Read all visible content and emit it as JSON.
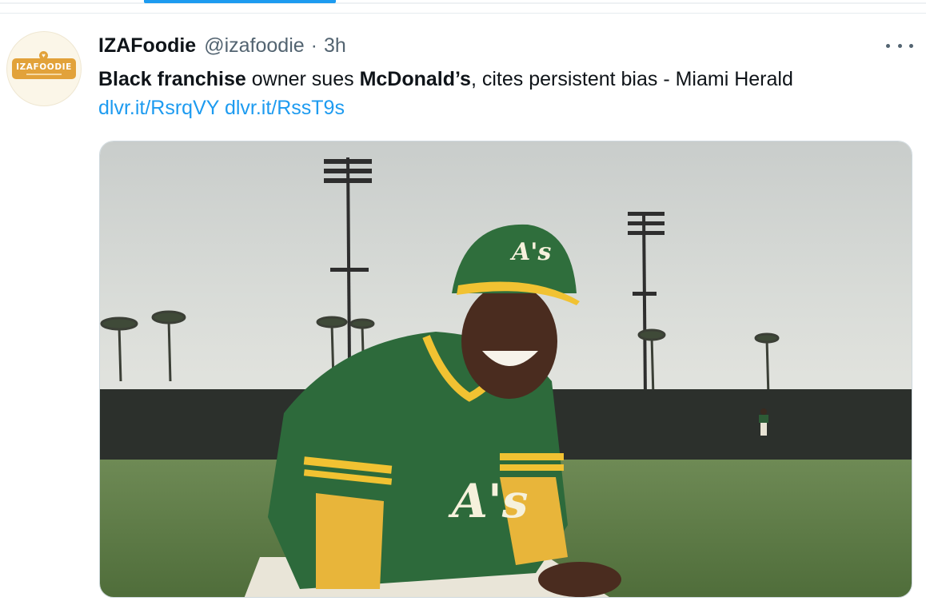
{
  "tweet": {
    "display_name": "IZAFoodie",
    "handle": "@izafoodie",
    "separator": "·",
    "time": "3h",
    "text_parts": {
      "bold1": "Black franchise",
      "plain1": " owner sues ",
      "bold2": "McDonald’s",
      "plain2": ", cites persistent bias - Miami Herald ",
      "link1": "dlvr.it/RsrqVY",
      "space": " ",
      "link2": "dlvr.it/RssT9s"
    },
    "more_icon": "more-horizontal-icon"
  },
  "avatar": {
    "logo_text": "IZAFOODIE",
    "logo_color": "#e2a23a",
    "heart_glyph": "♥"
  },
  "media": {
    "cap_logo": "A's",
    "jersey_logo": "A's"
  },
  "colors": {
    "link": "#1d9bf0",
    "secondary_text": "#536471",
    "green": "#1f6b3a",
    "gold": "#f1c232"
  }
}
